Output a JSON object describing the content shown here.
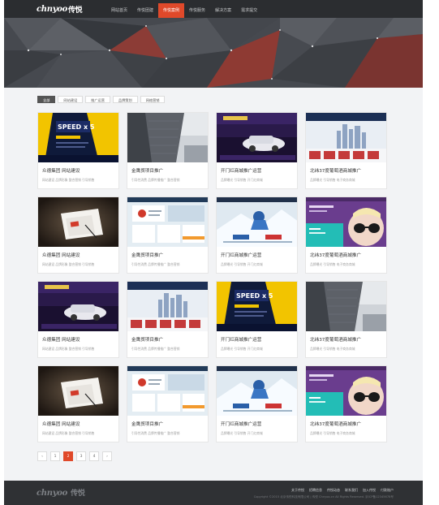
{
  "header": {
    "logo_text": "chnyoo",
    "logo_cn": "传悦",
    "nav": [
      {
        "label": "网站首页",
        "active": false
      },
      {
        "label": "传悦团建",
        "active": false
      },
      {
        "label": "传悦案例",
        "active": true
      },
      {
        "label": "传悦服务",
        "active": false
      },
      {
        "label": "解决方案",
        "active": false
      },
      {
        "label": "需求提交",
        "active": false
      }
    ]
  },
  "filters": [
    {
      "label": "全部",
      "active": true
    },
    {
      "label": "网站建设",
      "active": false
    },
    {
      "label": "推广运营",
      "active": false
    },
    {
      "label": "品牌策划",
      "active": false
    },
    {
      "label": "网络营销",
      "active": false
    }
  ],
  "cases": [
    {
      "title": "众德集团  网站建设",
      "tags": "网站建设  品牌形象  整合营销  引导销售",
      "thumb": "speed"
    },
    {
      "title": "金鹰贸项目推广",
      "tags": "引导性消费  品牌传播推广  整合营销",
      "thumb": "building"
    },
    {
      "title": "开门红商城推广运营",
      "tags": "品牌曝光  引导销售  开门红商城",
      "thumb": "car"
    },
    {
      "title": "北纬37度葡萄酒商城推广",
      "tags": "品牌曝光  引导销售  电子商务商城",
      "thumb": "city"
    },
    {
      "title": "众德集团  网站建设",
      "tags": "网站建设  品牌形象  整合营销  引导销售",
      "thumb": "paper"
    },
    {
      "title": "金鹰贸项目推广",
      "tags": "引导性消费  品牌传播推广  整合营销",
      "thumb": "web"
    },
    {
      "title": "开门红商城推广运营",
      "tags": "品牌曝光  引导销售  开门红商城",
      "thumb": "snow"
    },
    {
      "title": "北纬37度葡萄酒商城推广",
      "tags": "品牌曝光  引导销售  电子商务商城",
      "thumb": "fashion"
    },
    {
      "title": "众德集团  网站建设",
      "tags": "网站建设  品牌形象  整合营销  引导销售",
      "thumb": "car"
    },
    {
      "title": "金鹰贸项目推广",
      "tags": "引导性消费  品牌传播推广  整合营销",
      "thumb": "city"
    },
    {
      "title": "开门红商城推广运营",
      "tags": "品牌曝光  引导销售  开门红商城",
      "thumb": "speed"
    },
    {
      "title": "北纬37度葡萄酒商城推广",
      "tags": "品牌曝光  引导销售  电子商务商城",
      "thumb": "building"
    },
    {
      "title": "众德集团  网站建设",
      "tags": "网站建设  品牌形象  整合营销  引导销售",
      "thumb": "paper"
    },
    {
      "title": "金鹰贸项目推广",
      "tags": "引导性消费  品牌传播推广  整合营销",
      "thumb": "web"
    },
    {
      "title": "开门红商城推广运营",
      "tags": "品牌曝光  引导销售  开门红商城",
      "thumb": "snow"
    },
    {
      "title": "北纬37度葡萄酒商城推广",
      "tags": "品牌曝光  引导销售  电子商务商城",
      "thumb": "fashion"
    }
  ],
  "pagination": {
    "prev": "‹",
    "pages": [
      {
        "label": "1",
        "active": false
      },
      {
        "label": "2",
        "active": true
      },
      {
        "label": "3",
        "active": false
      },
      {
        "label": "4",
        "active": false
      }
    ],
    "next": "›"
  },
  "footer": {
    "logo_text": "chnyoo",
    "logo_cn": "传悦",
    "links": [
      "关于传悦",
      "招聘信息",
      "传悦动态",
      "联系我们",
      "加入传悦",
      "付款账户"
    ],
    "copyright": "Copyright ©2015  北京传悦科技有限公司    |    传悦 Chnyoo.cn All Rights Reserved.     京ICP备12345678号"
  },
  "colors": {
    "accent": "#e0492a",
    "header_bg": "#2b2d30",
    "footer_bg": "#2f3134",
    "page_bg": "#f2f3f5"
  }
}
